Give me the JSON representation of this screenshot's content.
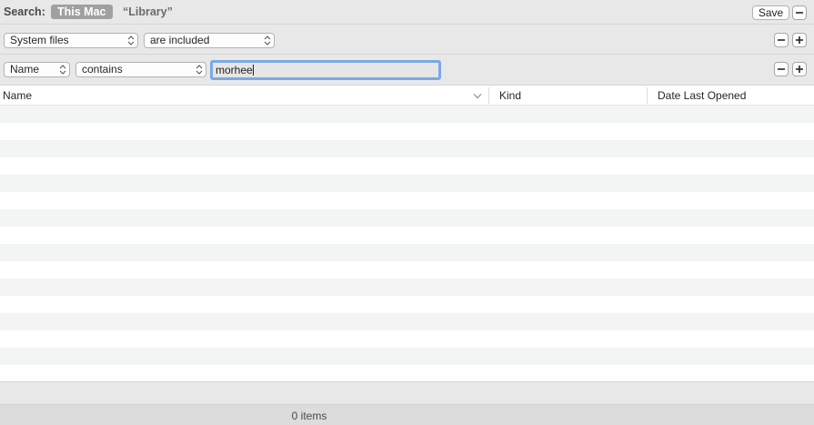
{
  "search": {
    "label": "Search:",
    "scopes": [
      "This Mac",
      "“Library”"
    ],
    "save_label": "Save"
  },
  "rules": [
    {
      "attribute": "System files",
      "operator": "are included"
    },
    {
      "attribute": "Name",
      "operator": "contains",
      "value": "morhee"
    }
  ],
  "table": {
    "columns": [
      "Name",
      "Kind",
      "Date Last Opened"
    ],
    "sorted_column": "Name",
    "rows": []
  },
  "status": {
    "item_count": "0 items"
  },
  "icons": [
    "minus-icon",
    "plus-icon",
    "up-down-arrows-icon",
    "sort-chevron-down-icon"
  ],
  "colors": {
    "focus_ring": "#7aa9e6",
    "scope_selected_bg": "#a0a0a0",
    "row_stripe": "#f3f4f4"
  }
}
